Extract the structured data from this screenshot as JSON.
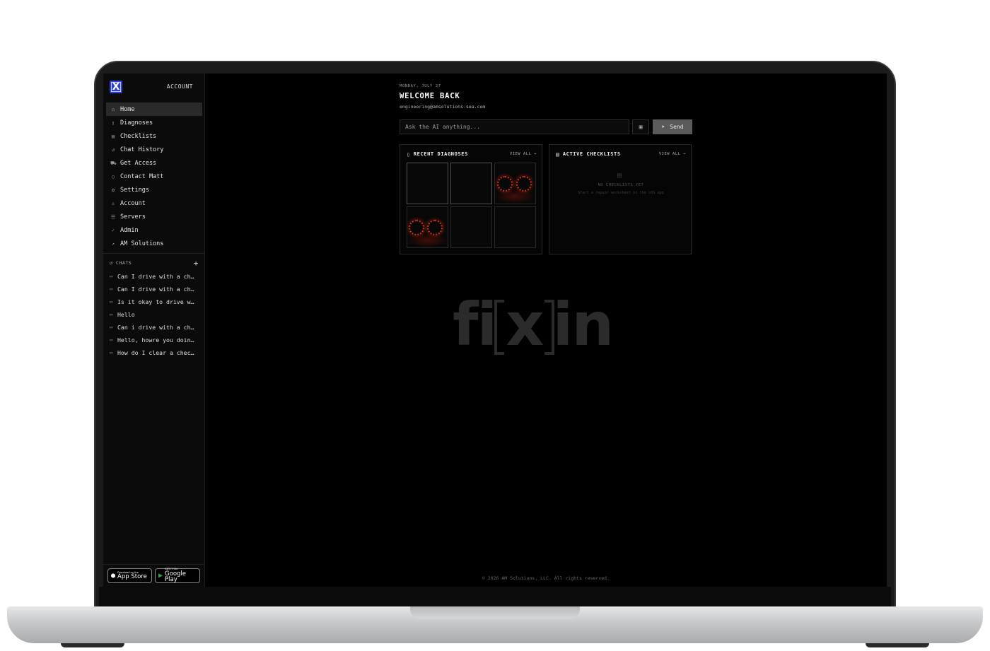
{
  "sidebar": {
    "logo": "X",
    "account_label": "ACCOUNT",
    "nav": [
      {
        "label": "Home",
        "icon": "home-icon",
        "glyph": "⌂",
        "active": true
      },
      {
        "label": "Diagnoses",
        "icon": "phone-icon",
        "glyph": "▯"
      },
      {
        "label": "Checklists",
        "icon": "clipboard-icon",
        "glyph": "▤"
      },
      {
        "label": "Chat History",
        "icon": "history-icon",
        "glyph": "↺"
      },
      {
        "label": "Get Access",
        "icon": "cart-icon",
        "glyph": "⛟"
      },
      {
        "label": "Contact Matt",
        "icon": "message-circle-icon",
        "glyph": "○"
      },
      {
        "label": "Settings",
        "icon": "gear-icon",
        "glyph": "⚙"
      },
      {
        "label": "Account",
        "icon": "user-icon",
        "glyph": "♙"
      },
      {
        "label": "Servers",
        "icon": "server-icon",
        "glyph": "☰"
      },
      {
        "label": "Admin",
        "icon": "shield-check-icon",
        "glyph": "✓"
      },
      {
        "label": "AM Solutions",
        "icon": "external-link-icon",
        "glyph": "↗"
      }
    ],
    "chats_label": "CHATS",
    "chats_add": "+",
    "chats": [
      "Can I drive with a ch…",
      "Can I drive with a ch…",
      "Is it okay to drive w…",
      "Hello",
      "Can i drive with a ch…",
      "Hello, howre you doin…",
      "How do I clear a chec…"
    ],
    "app_store": {
      "small": "Download on the",
      "big": "App Store"
    },
    "google_play": {
      "small": "GET IT ON",
      "big": "Google Play"
    }
  },
  "main": {
    "date": "MONDAY, JULY 27",
    "welcome": "WELCOME BACK",
    "email": "engineering@amsolutions-sea.com",
    "ask_placeholder": "Ask the AI anything...",
    "send_label": "Send",
    "recent": {
      "title": "RECENT DIAGNOSES",
      "view_all": "VIEW ALL →"
    },
    "checklists": {
      "title": "ACTIVE CHECKLISTS",
      "view_all": "VIEW ALL →",
      "empty_title": "NO CHECKLISTS YET",
      "empty_sub": "Start a repair worksheet in the iOS app"
    },
    "wordmark": {
      "a": "fi",
      "b": "x",
      "c": "in"
    },
    "footer": "© 2026 AM Solutions, LLC. All rights reserved."
  },
  "colors": {
    "accent": "#2e3fd1",
    "gauge_red": "#d9301c",
    "send_bg": "#5a5a5a"
  }
}
